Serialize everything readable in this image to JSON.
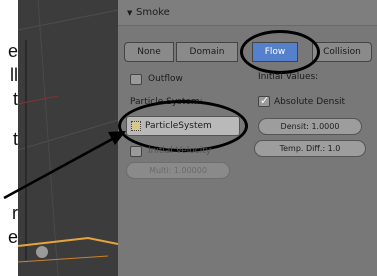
{
  "doc_text_fragments": [
    "e",
    "ll",
    "t",
    "t",
    "r",
    "e"
  ],
  "panel": {
    "header_title": "Smoke",
    "type_buttons": [
      "None",
      "Domain",
      "Flow",
      "Collision"
    ],
    "active_type": "Flow",
    "outflow_label": "Outflow",
    "initial_values_label": "Initial Values:",
    "particle_system_label": "Particle System:",
    "absolute_density_label": "Absolute Densit",
    "particle_system_value": "ParticleSystem",
    "density_field": "Densit: 1.0000",
    "initial_velocity_label": "Initial Velocity",
    "temp_diff_field": "Temp. Diff.: 1.0",
    "multiplier_field": "Multi: 1.00000"
  },
  "colors": {
    "panel_bg": "#787878",
    "active_button": "#5580cc",
    "viewport_bg": "#3c3c3c",
    "selection_outline": "#e8a33c"
  }
}
